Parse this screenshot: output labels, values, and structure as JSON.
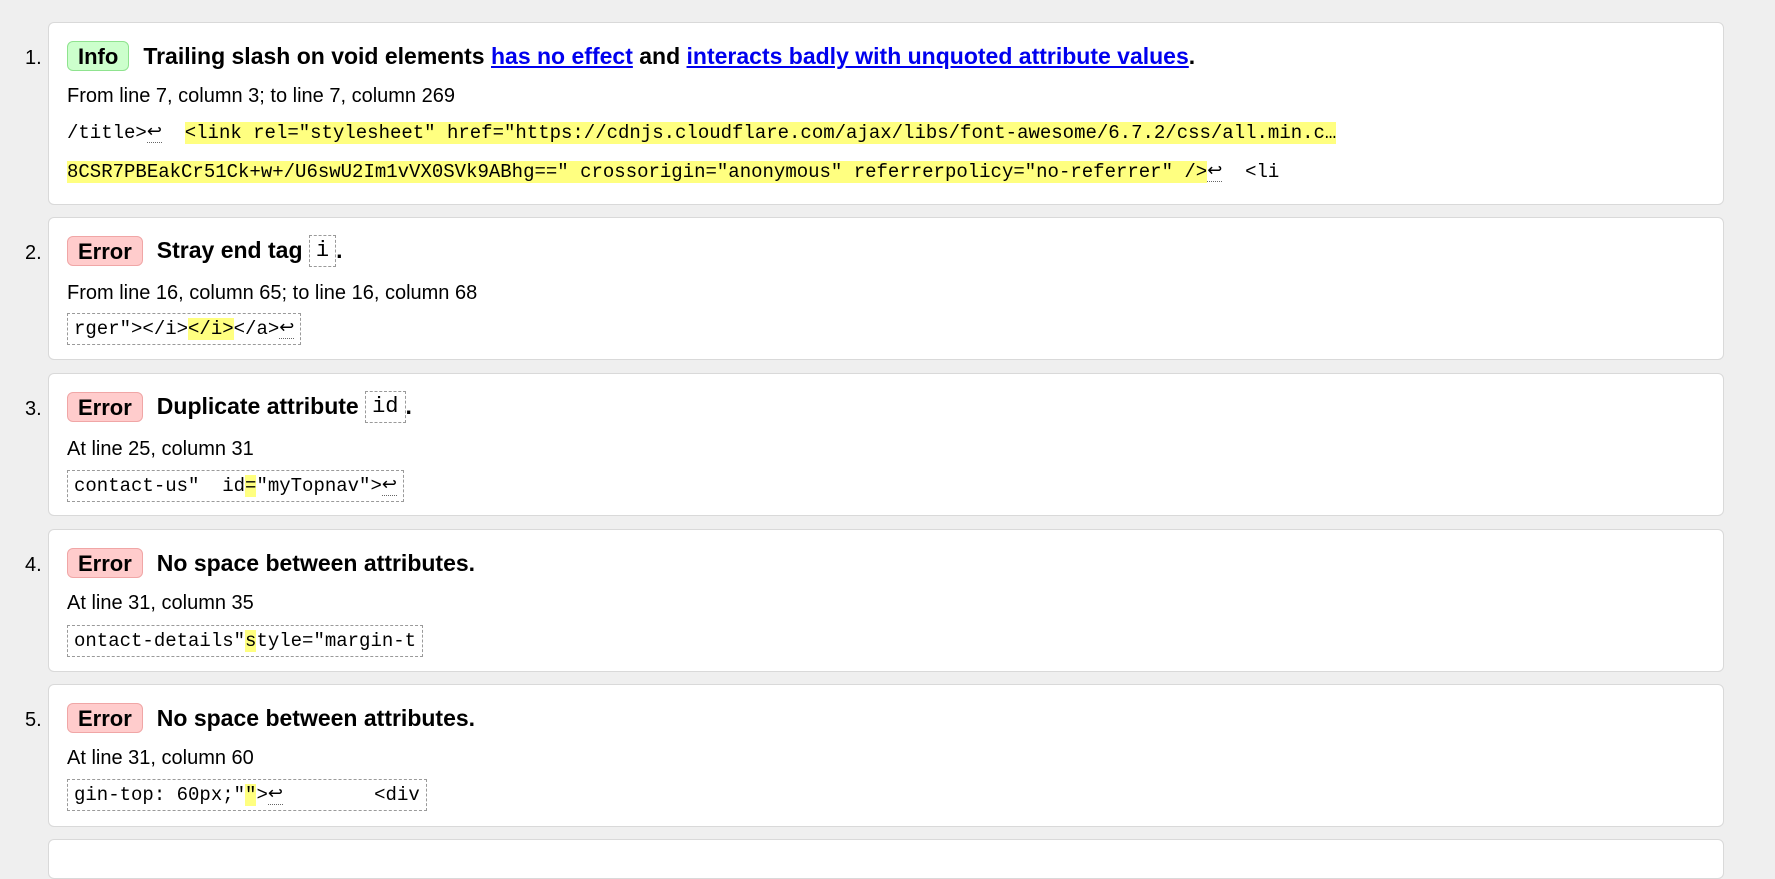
{
  "messages": [
    {
      "number": "1.",
      "badge": "Info",
      "message_parts": {
        "prefix": "Trailing slash on void elements ",
        "link1": "has no effect",
        "middle": " and ",
        "link2": "interacts badly with unquoted attribute values",
        "suffix": "."
      },
      "location": "From line 7, column 3; to line 7, column 269",
      "extract_line1": {
        "before": "/title>",
        "return": "↩",
        "gap": "  ",
        "highlight": "<link rel=\"stylesheet\" href=\"https://cdnjs.cloudflare.com/ajax/libs/font-awesome/6.7.2/css/all.min.c…"
      },
      "extract_line2": {
        "highlight": "8CSR7PBEakCr51Ck+w+/U6swU2Im1vVX0SVk9ABhg==\" crossorigin=\"anonymous\" referrerpolicy=\"no-referrer\" />",
        "return": "↩",
        "after": "  <li"
      }
    },
    {
      "number": "2.",
      "badge": "Error",
      "message_parts": {
        "prefix": "Stray end tag ",
        "code": "i",
        "suffix": "."
      },
      "location": "From line 16, column 65; to line 16, column 68",
      "extract": {
        "before": "rger\"></i>",
        "highlight": "</i>",
        "after": "</a>",
        "return": "↩"
      }
    },
    {
      "number": "3.",
      "badge": "Error",
      "message_parts": {
        "prefix": "Duplicate attribute ",
        "code": "id",
        "suffix": "."
      },
      "location": "At line 25, column 31",
      "extract": {
        "before": "contact-us\"  id",
        "highlight": "=",
        "after": "\"myTopnav\">",
        "return": "↩"
      }
    },
    {
      "number": "4.",
      "badge": "Error",
      "message": "No space between attributes.",
      "location": "At line 31, column 35",
      "extract": {
        "before": "ontact-details\"",
        "highlight": "s",
        "after": "tyle=\"margin-t"
      }
    },
    {
      "number": "5.",
      "badge": "Error",
      "message": "No space between attributes.",
      "location": "At line 31, column 60",
      "extract": {
        "before": "gin-top: 60px;\"",
        "highlight": "\"",
        "after": ">",
        "return": "↩",
        "tail": "        <div"
      }
    }
  ],
  "colors": {
    "page_background": "#efefef",
    "card_background": "#ffffff",
    "info_badge": "#ccffcc",
    "error_badge": "#ffcccc",
    "highlight": "#ffff80",
    "link": "#0000ee"
  }
}
